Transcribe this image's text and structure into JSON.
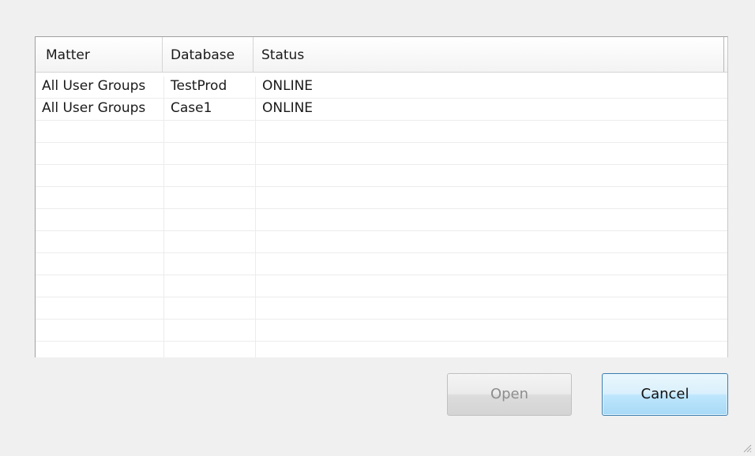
{
  "grid": {
    "columns": [
      "Matter",
      "Database",
      "Status"
    ],
    "rows": [
      {
        "matter": "All User Groups",
        "database": "TestProd",
        "status": "ONLINE"
      },
      {
        "matter": "All User Groups",
        "database": "Case1",
        "status": "ONLINE"
      }
    ]
  },
  "buttons": {
    "open_label": "Open",
    "open_enabled": false,
    "cancel_label": "Cancel"
  },
  "icons": {
    "resize_grip": "resize-grip-icon"
  }
}
